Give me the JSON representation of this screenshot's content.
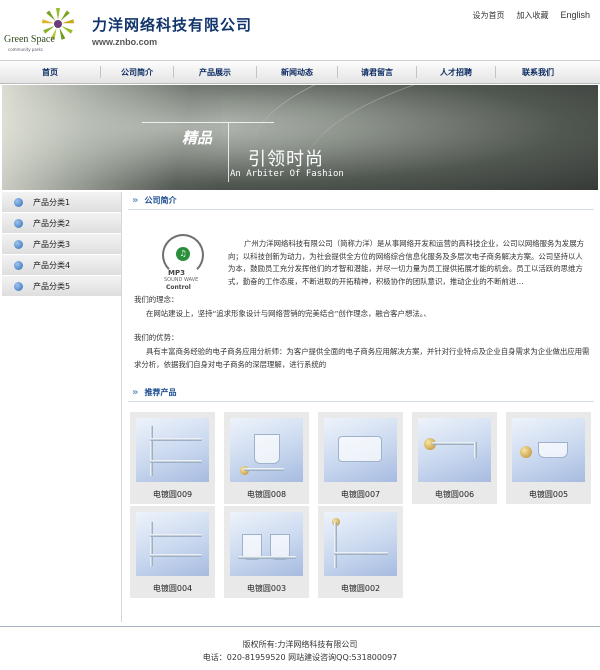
{
  "header": {
    "logo_text": "Green Space",
    "logo_sub": "community parks",
    "company_name": "力洋网络科技有限公司",
    "domain": "www.znbo.com",
    "top_links": [
      "设为首页",
      "加入收藏",
      "English"
    ]
  },
  "nav": {
    "items": [
      "首页",
      "公司简介",
      "产品展示",
      "新闻动态",
      "请君留言",
      "人才招聘",
      "联系我们"
    ]
  },
  "banner": {
    "slogan_cn_bold": "精品",
    "slogan_cn": "引领时尚",
    "slogan_en": "An Arbiter Of Fashion"
  },
  "sidebar": {
    "categories": [
      "产品分类1",
      "产品分类2",
      "产品分类3",
      "产品分类4",
      "产品分类5"
    ]
  },
  "about": {
    "section_title": "公司简介",
    "mp3_logo": {
      "line1": "MP3",
      "line2": "SOUND WAVE",
      "line3": "Control"
    },
    "intro": "广州力洋网络科技有限公司（简称力洋）是从事网络开发和运营的高科技企业，公司以网络服务为发展方向；以科技创新为动力，为社会提供全方位的网络综合信息化服务及多层次电子商务解决方案。公司坚持以人为本，鼓励员工充分发挥他们的才智和潜能，并尽一切力量为员工提供拓展才能的机会。员工以活跃的思维方式，勤奋的工作态度，不断进取的开拓精神，积极协作的团队意识，推动企业的不断前进…",
    "idea_title": "我们的理念：",
    "idea_text": "在网站建设上，坚持“追求形象设计与网络营销的完美结合”创作理念，融合客户想法。、",
    "advantage_title": "我们的优势：",
    "advantage_text": "具有丰富商务经验的电子商务应用分析师：为客户提供全面的电子商务应用解决方案，并针对行业特点及企业自身需求为企业做出应用需求分析，依据我们自身对电子商务的深层理解，进行系统的"
  },
  "products": {
    "section_title": "推荐产品",
    "items": [
      {
        "name": "电镀圆009",
        "kind": "double-shelf"
      },
      {
        "name": "电镀圆008",
        "kind": "cup-holder"
      },
      {
        "name": "电镀圆007",
        "kind": "tissue-box"
      },
      {
        "name": "电镀圆006",
        "kind": "paper-holder"
      },
      {
        "name": "电镀圆005",
        "kind": "soap-dish"
      },
      {
        "name": "电镀圆004",
        "kind": "double-shelf"
      },
      {
        "name": "电镀圆003",
        "kind": "double-cup"
      },
      {
        "name": "电镀圆002",
        "kind": "glass-shelf"
      }
    ]
  },
  "footer": {
    "copyright": "版权所有:力洋网络科技有限公司",
    "contact": "电话：020-81959520 网站建设咨询QQ:531800097"
  },
  "colors": {
    "nav_text": "#0d2c62",
    "section_title": "#1a4a90",
    "company_name": "#12366c"
  }
}
